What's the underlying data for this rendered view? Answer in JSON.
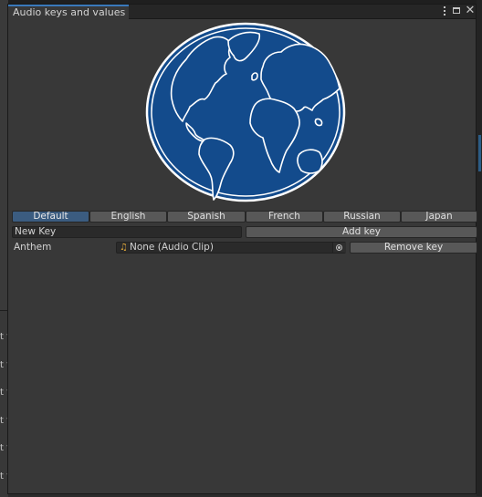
{
  "window": {
    "tab_title": "Audio keys and values"
  },
  "icons": {
    "menu": "kebab-menu-icon",
    "maximize": "maximize-icon",
    "close": "close-icon",
    "globe": "globe-icon",
    "audio": "music-note-icon",
    "picker": "object-picker-icon"
  },
  "colors": {
    "globe_fill": "#134b8c",
    "active_tab": "#3b5c80",
    "audio_icon": "#e2a93a"
  },
  "languages": {
    "tabs": [
      "Default",
      "English",
      "Spanish",
      "French",
      "Russian",
      "Japan"
    ],
    "selected": "Default"
  },
  "new_key": {
    "value": "New Key",
    "add_label": "Add key"
  },
  "entries": [
    {
      "key": "Anthem",
      "value": "None (Audio Clip)",
      "remove_label": "Remove key"
    }
  ],
  "background": {
    "row_fragments": [
      "t fo",
      "t f",
      "t f",
      "t f",
      "t fo",
      "t f"
    ]
  }
}
